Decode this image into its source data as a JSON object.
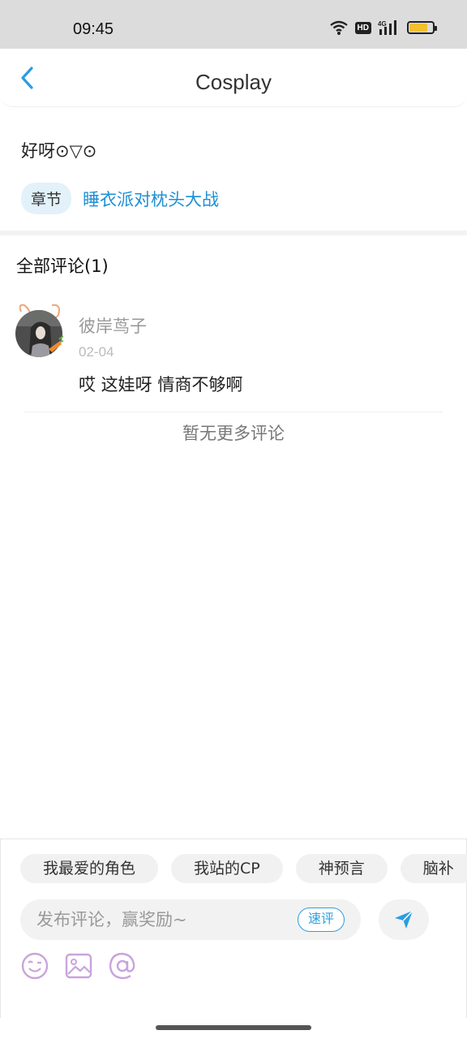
{
  "status_bar": {
    "time": "09:45",
    "hd_label": "HD",
    "network_label": "4G",
    "battery_level": 0.8,
    "battery_color": "#f2c030"
  },
  "nav": {
    "title": "Cosplay",
    "back_icon": "chevron-left-icon",
    "accent": "#2a9de0"
  },
  "post": {
    "text": "好呀⊙▽⊙",
    "chapter_tag": "章节",
    "chapter_link": "睡衣派对枕头大战"
  },
  "comments": {
    "header": "全部评论(1)",
    "items": [
      {
        "user": "彼岸茑子",
        "date": "02-04",
        "body": "哎 这娃呀 情商不够啊",
        "avatar_icon": "bunny-ear-avatar-icon"
      }
    ],
    "no_more": "暂无更多评论"
  },
  "composer": {
    "chips": [
      "我最爱的角色",
      "我站的CP",
      "神预言",
      "脑补"
    ],
    "placeholder": "发布评论，赢奖励~",
    "quick_review": "速评",
    "send_icon": "send-plane-icon",
    "tools": [
      "emoji-icon",
      "image-icon",
      "at-icon"
    ],
    "tool_color": "#c9a4dc"
  }
}
